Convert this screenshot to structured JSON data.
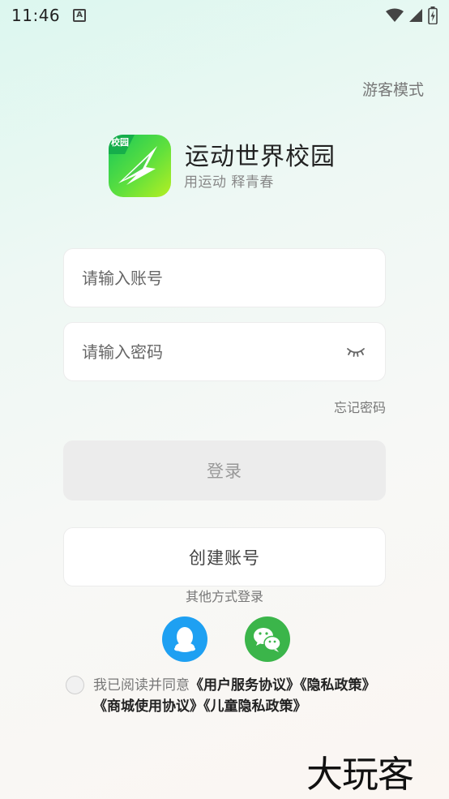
{
  "status_bar": {
    "time": "11:46",
    "notification_letter": "A"
  },
  "header": {
    "guest_mode": "游客模式"
  },
  "app": {
    "logo_badge": "校园",
    "title": "运动世界校园",
    "slogan": "用运动 释青春"
  },
  "form": {
    "account_placeholder": "请输入账号",
    "password_placeholder": "请输入密码",
    "forgot_password": "忘记密码",
    "login_label": "登录",
    "create_account_label": "创建账号"
  },
  "social": {
    "heading": "其他方式登录",
    "qq_icon": "qq-icon",
    "wechat_icon": "wechat-icon"
  },
  "agreement": {
    "prefix": "我已阅读并同意",
    "links": [
      "《用户服务协议》",
      "《隐私政策》",
      "《商城使用协议》",
      "《儿童隐私政策》"
    ]
  },
  "watermark": "大玩客",
  "colors": {
    "qq": "#1ea0f2",
    "wechat": "#3bb54a",
    "logo_green": "#16c75a"
  }
}
